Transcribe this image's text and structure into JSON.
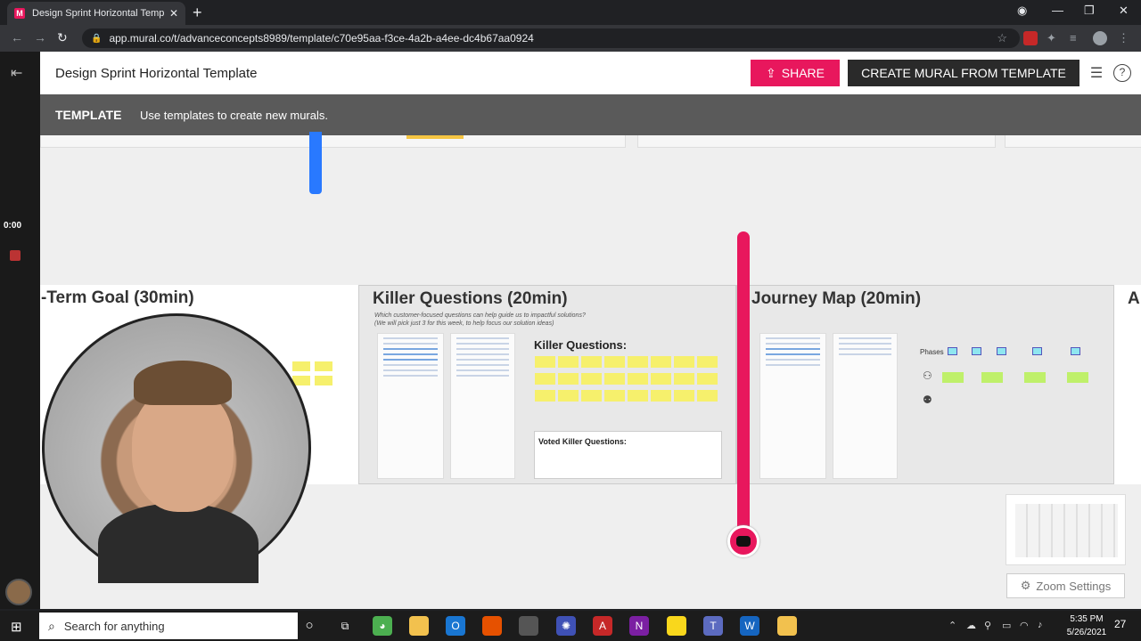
{
  "browser": {
    "tab_title": "Design Sprint Horizontal Template",
    "tab_close": "✕",
    "new_tab": "+",
    "url": "app.mural.co/t/advanceconcepts8989/template/c70e95aa-f3ce-4a2b-a4ee-dc4b67aa0924",
    "back": "←",
    "forward": "→",
    "reload": "↻"
  },
  "header": {
    "title": "Design Sprint Horizontal Template",
    "share_label": "SHARE",
    "create_label": "CREATE MURAL FROM TEMPLATE"
  },
  "banner": {
    "label": "TEMPLATE",
    "text": "Use templates to create new murals."
  },
  "recording": {
    "time": "0:00"
  },
  "canvas": {
    "frames": [
      {
        "title": "-Term Goal (30min)"
      },
      {
        "title": "Killer Questions (20min)"
      },
      {
        "title": "Journey Map (20min)"
      },
      {
        "title": "A"
      }
    ],
    "killer": {
      "subtitle_1": "Which customer-focused questions can help guide us to impactful solutions?",
      "subtitle_2": "(We will pick just 3 for this week, to help focus our solution ideas)",
      "sticky_header": "Killer Questions:",
      "voted_header": "Voted Killer Questions:"
    },
    "journey": {
      "phases_label": "Phases"
    }
  },
  "zoom": {
    "label": "Zoom Settings"
  },
  "taskbar": {
    "search_placeholder": "Search for anything",
    "time": "5:35 PM",
    "date": "5/26/2021",
    "notifications": "27"
  },
  "colors": {
    "accent": "#e8175d",
    "dark_button": "#2a2a2a",
    "banner": "#5a5a5a"
  }
}
